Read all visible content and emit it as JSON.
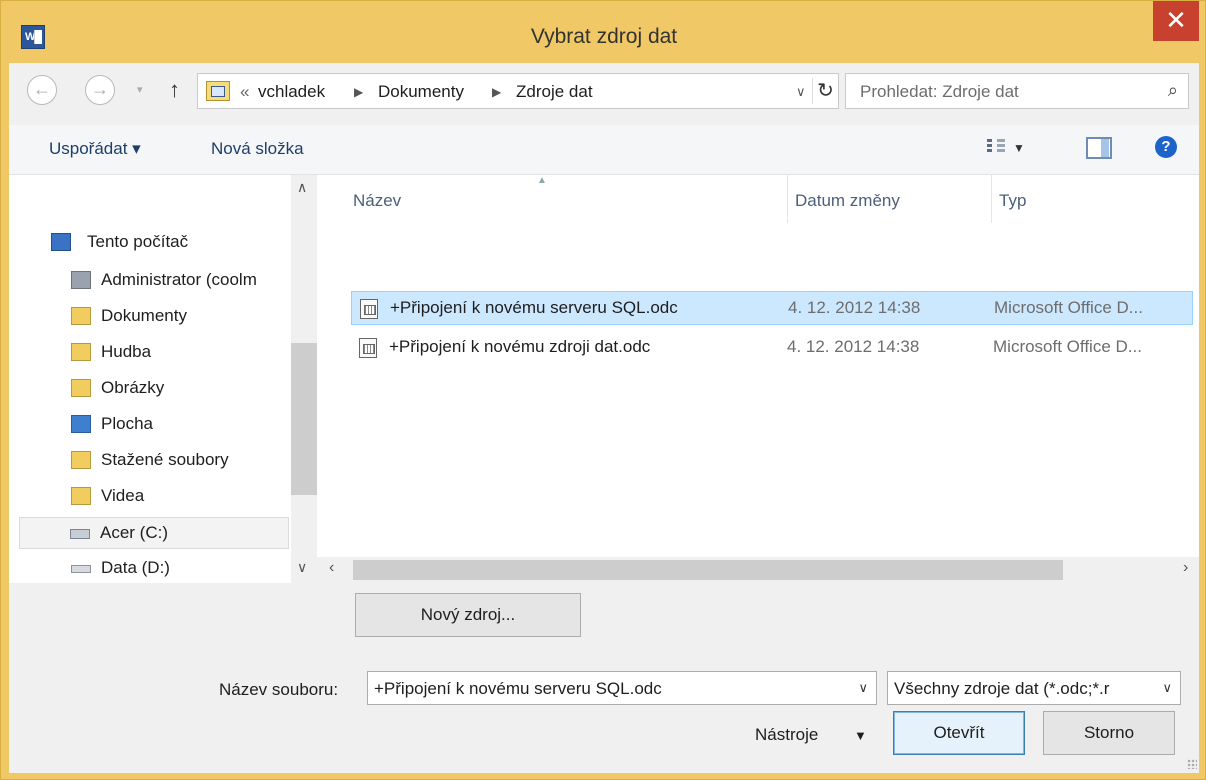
{
  "window": {
    "title": "Vybrat zdroj dat",
    "app_icon": "W"
  },
  "address": {
    "crumbs": [
      "vchladek",
      "Dokumenty",
      "Zdroje dat"
    ],
    "overflow": "«",
    "search_placeholder": "Prohledat: Zdroje dat"
  },
  "toolbar": {
    "organize": "Uspořádat ▾",
    "new_folder": "Nová složka"
  },
  "nav": {
    "root": "Tento počítač",
    "items": [
      "Administrator (coolm",
      "Dokumenty",
      "Hudba",
      "Obrázky",
      "Plocha",
      "Stažené soubory",
      "Videa"
    ],
    "drives": [
      "Acer (C:)",
      "Data (D:)"
    ]
  },
  "columns": {
    "name": "Název",
    "date": "Datum změny",
    "type": "Typ"
  },
  "files": [
    {
      "name": "+Připojení k novému serveru SQL.odc",
      "date": "4. 12. 2012 14:38",
      "type": "Microsoft Office D...",
      "selected": true
    },
    {
      "name": "+Připojení k novému zdroji dat.odc",
      "date": "4. 12. 2012 14:38",
      "type": "Microsoft Office D...",
      "selected": false
    }
  ],
  "footer": {
    "new_source": "Nový zdroj...",
    "filename_label": "Název souboru:",
    "filename_value": "+Připojení k novému serveru SQL.odc",
    "filter_value": "Všechny zdroje dat (*.odc;*.r",
    "tools": "Nástroje",
    "open": "Otevřít",
    "cancel": "Storno"
  }
}
